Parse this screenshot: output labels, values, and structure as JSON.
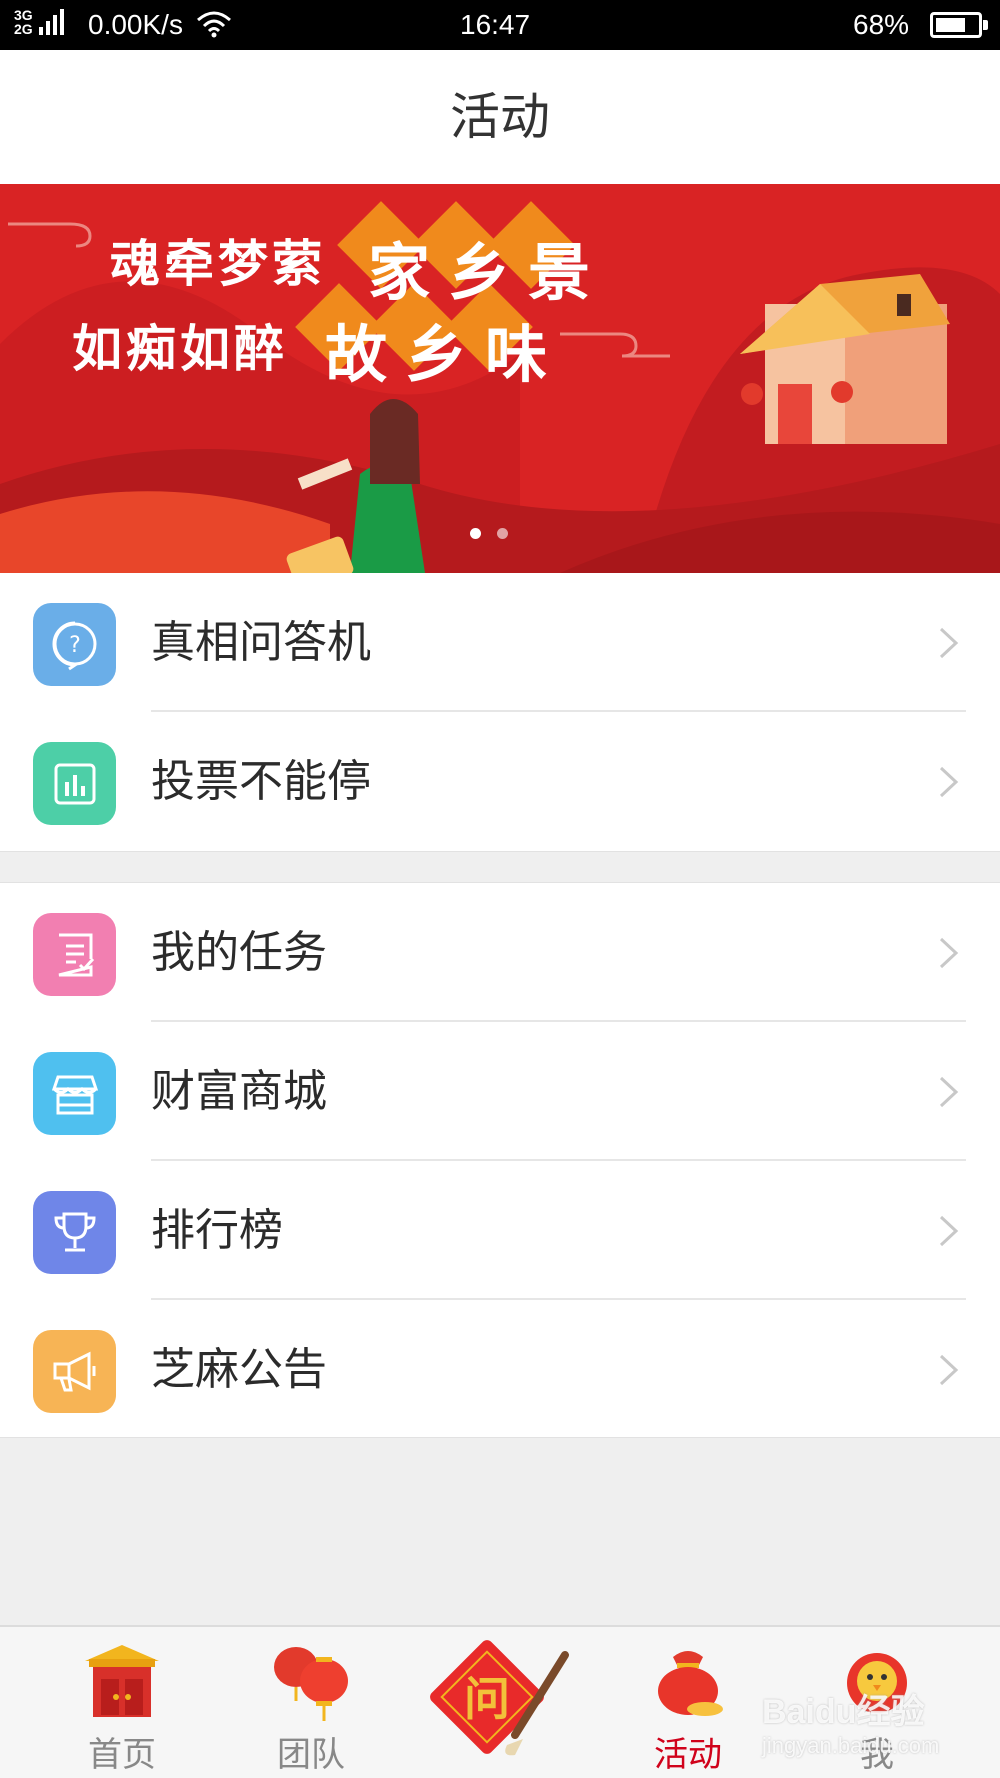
{
  "status_bar": {
    "network_top": "3G",
    "network_bottom": "2G",
    "speed": "0.00K/s",
    "time": "16:47",
    "battery": "68%"
  },
  "header": {
    "title": "活动"
  },
  "banner": {
    "line1": "魂牵梦萦",
    "highlight1": "家乡景",
    "line2": "如痴如醉",
    "highlight2": "故乡味",
    "slide_count": 2,
    "active_slide": 1
  },
  "menu": {
    "group1": [
      {
        "label": "真相问答机",
        "icon": "question-bubble-icon",
        "color": "#6aaee8"
      },
      {
        "label": "投票不能停",
        "icon": "bar-chart-icon",
        "color": "#4dcfa7"
      }
    ],
    "group2": [
      {
        "label": "我的任务",
        "icon": "task-list-icon",
        "color": "#f27fb1"
      },
      {
        "label": "财富商城",
        "icon": "shop-icon",
        "color": "#4fc0ef"
      },
      {
        "label": "排行榜",
        "icon": "trophy-icon",
        "color": "#6f86e8"
      },
      {
        "label": "芝麻公告",
        "icon": "megaphone-icon",
        "color": "#f7b455"
      }
    ]
  },
  "bottom_nav": {
    "items": [
      {
        "label": "首页",
        "icon": "temple-gate-icon"
      },
      {
        "label": "团队",
        "icon": "lantern-icon"
      },
      {
        "label": "",
        "icon": "calligraphy-brush-icon",
        "center_char": "问"
      },
      {
        "label": "活动",
        "icon": "lucky-bag-icon",
        "active": true
      },
      {
        "label": "我",
        "icon": "chick-icon"
      }
    ]
  },
  "watermark": {
    "brand": "Baidu经验",
    "url": "jingyan.baidu.com"
  },
  "colors": {
    "accent": "#d0021b",
    "banner_red": "#d92324",
    "diamond_orange": "#f08a1c"
  }
}
